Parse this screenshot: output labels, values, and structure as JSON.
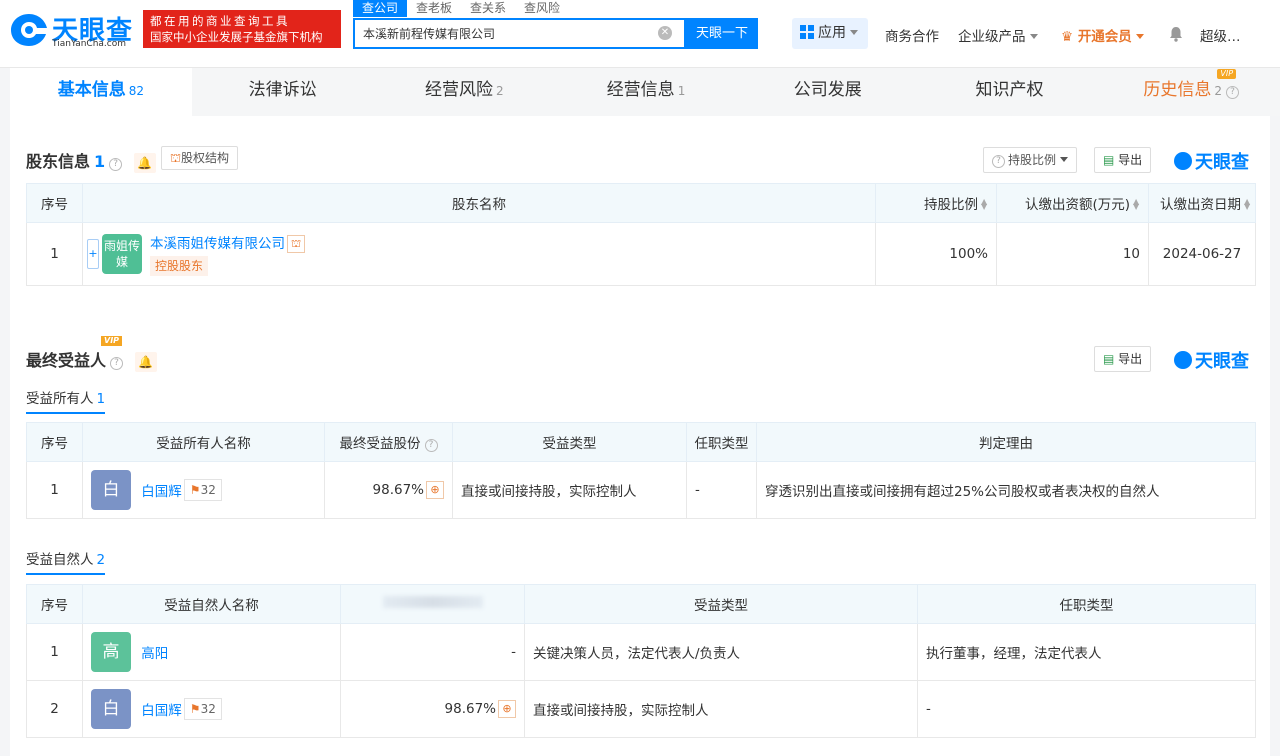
{
  "header": {
    "logo_cn": "天眼查",
    "logo_en": "TianYanCha.com",
    "slogan_line1": "都在用的商业查询工具",
    "slogan_line2": "国家中小企业发展子基金旗下机构",
    "search_tabs": [
      "查公司",
      "查老板",
      "查关系",
      "查风险"
    ],
    "search_value": "本溪新前程传媒有限公司",
    "search_button": "天眼一下",
    "app_label": "应用",
    "nav_business": "商务合作",
    "nav_enterprise": "企业级产品",
    "nav_vip": "开通会员",
    "nav_user": "超级…"
  },
  "tabs": [
    {
      "label": "基本信息",
      "count": "82"
    },
    {
      "label": "法律诉讼",
      "count": ""
    },
    {
      "label": "经营风险",
      "count": "2"
    },
    {
      "label": "经营信息",
      "count": "1"
    },
    {
      "label": "公司发展",
      "count": ""
    },
    {
      "label": "知识产权",
      "count": ""
    },
    {
      "label": "历史信息",
      "count": "2",
      "vip": "VIP"
    }
  ],
  "shareholders": {
    "title": "股东信息",
    "count": "1",
    "structure_button": "股权结构",
    "ratio_button": "持股比例",
    "export_button": "导出",
    "brand": "天眼查",
    "columns": [
      "序号",
      "股东名称",
      "持股比例",
      "认缴出资额(万元)",
      "认缴出资日期"
    ],
    "rows": [
      {
        "no": "1",
        "avatar": "雨姐传媒",
        "name": "本溪雨姐传媒有限公司",
        "tag": "控股股东",
        "ratio": "100%",
        "amount": "10",
        "date": "2024-06-27"
      }
    ]
  },
  "beneficiary": {
    "title": "最终受益人",
    "vip": "VIP",
    "export_button": "导出",
    "brand": "天眼查",
    "owners_tab": {
      "label": "受益所有人",
      "count": "1"
    },
    "owners_columns": [
      "序号",
      "受益所有人名称",
      "最终受益股份",
      "受益类型",
      "任职类型",
      "判定理由"
    ],
    "owners_rows": [
      {
        "no": "1",
        "avatar": "白",
        "name": "白国辉",
        "badge": "32",
        "share": "98.67%",
        "type": "直接或间接持股，实际控制人",
        "role": "-",
        "reason": "穿透识别出直接或间接拥有超过25%公司股权或者表决权的自然人"
      }
    ],
    "natural_tab": {
      "label": "受益自然人",
      "count": "2"
    },
    "natural_columns": [
      "序号",
      "受益自然人名称",
      "",
      "受益类型",
      "任职类型"
    ],
    "natural_rows": [
      {
        "no": "1",
        "avatar": "高",
        "name": "高阳",
        "badge": "",
        "share": "-",
        "type": "关键决策人员，法定代表人/负责人",
        "role": "执行董事，经理，法定代表人"
      },
      {
        "no": "2",
        "avatar": "白",
        "name": "白国辉",
        "badge": "32",
        "share": "98.67%",
        "type": "直接或间接持股，实际控制人",
        "role": "-"
      }
    ]
  },
  "colors": {
    "brand": "#0084ff",
    "slogan_bg": "#e2241a",
    "vip": "#e8762c",
    "avatar_bai": "#7b93c6",
    "avatar_gao": "#5cc29a",
    "avatar_company": "#4fbf95"
  }
}
